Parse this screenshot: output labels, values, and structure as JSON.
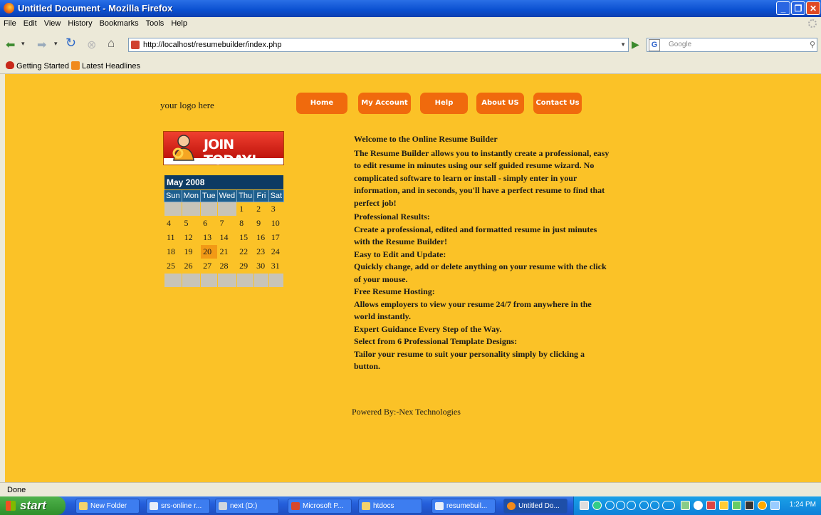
{
  "window": {
    "title": "Untitled Document - Mozilla Firefox"
  },
  "menu": [
    "File",
    "Edit",
    "View",
    "History",
    "Bookmarks",
    "Tools",
    "Help"
  ],
  "toolbar": {
    "url": "http://localhost/resumebuilder/index.php",
    "search_placeholder": "Google"
  },
  "bookmarks": [
    "Getting Started",
    "Latest Headlines"
  ],
  "page": {
    "logo": "your logo here",
    "nav": [
      "Home",
      "My Account",
      "Help",
      "About US",
      "Contact Us"
    ],
    "join_label": "JOIN TODAY!",
    "calendar": {
      "month": "May 2008",
      "days": [
        "Sun",
        "Mon",
        "Tue",
        "Wed",
        "Thu",
        "Fri",
        "Sat"
      ],
      "weeks": [
        [
          "",
          "",
          "",
          "",
          "1",
          "2",
          "3"
        ],
        [
          "4",
          "5",
          "6",
          "7",
          "8",
          "9",
          "10"
        ],
        [
          "11",
          "12",
          "13",
          "14",
          "15",
          "16",
          "17"
        ],
        [
          "18",
          "19",
          "20",
          "21",
          "22",
          "23",
          "24"
        ],
        [
          "25",
          "26",
          "27",
          "28",
          "29",
          "30",
          "31"
        ],
        [
          "",
          "",
          "",
          "",
          "",
          "",
          ""
        ]
      ],
      "today": "20"
    },
    "welcome": "Welcome to the Online Resume Builder",
    "intro": "The Resume Builder allows you to instantly create a professional, easy to edit resume in minutes using our self guided resume wizard. No complicated software to learn or install - simply enter in your information, and in seconds, you'll have a perfect resume to find that perfect job!",
    "features": [
      {
        "heading": "Professional Results:",
        "text": "Create a professional, edited and formatted resume in just minutes with the Resume Builder!"
      },
      {
        "heading": "Easy to Edit and Update:",
        "text": "Quickly change, add or delete anything on your resume with the click of your mouse."
      },
      {
        "heading": "Free Resume Hosting:",
        "text": "Allows employers to view your resume 24/7 from anywhere in the world instantly."
      },
      {
        "heading": "Expert Guidance Every Step of the Way.",
        "text": ""
      },
      {
        "heading": "Select from 6 Professional Template Designs:",
        "text": "Tailor your resume to suit your personality simply by clicking a button."
      }
    ],
    "powered": "Powered By:-Nex Technologies"
  },
  "status": "Done",
  "taskbar": {
    "start": "start",
    "items": [
      "New Folder",
      "srs-online r...",
      "next (D:)",
      "Microsoft P...",
      "htdocs",
      "resumebuil...",
      "Untitled Do..."
    ],
    "clock": "1:24 PM"
  },
  "colors": {
    "page_bg": "#fbc227",
    "nav_button": "#f06a0d",
    "calendar_header": "#0d3a63",
    "today": "#f29a16"
  }
}
